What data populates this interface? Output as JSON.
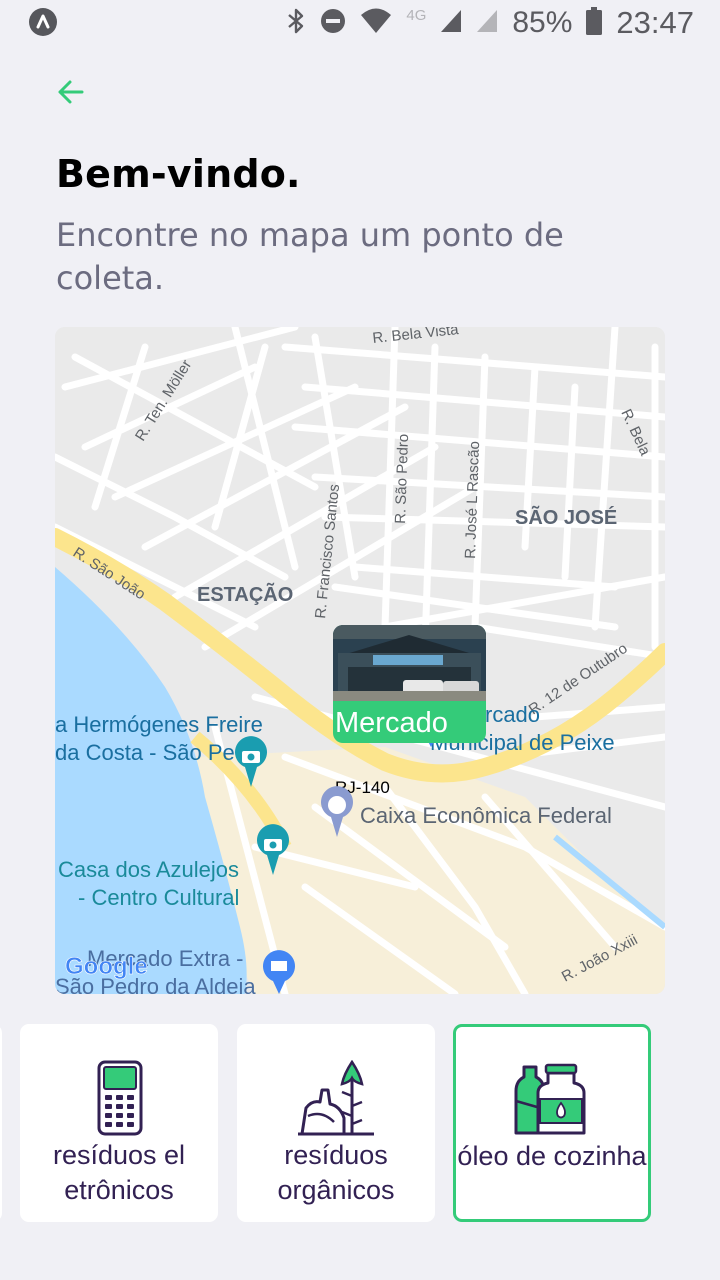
{
  "status_bar": {
    "network": "4G",
    "battery_percent": "85%",
    "time": "23:47",
    "icons": [
      "app-notification-icon",
      "bluetooth-icon",
      "do-not-disturb-icon",
      "wifi-icon",
      "signal-icon",
      "signal-icon",
      "battery-icon"
    ]
  },
  "header": {
    "back_icon": "arrow-left-icon",
    "title": "Bem-vindo.",
    "subtitle": "Encontre no mapa um ponto de coleta."
  },
  "map": {
    "streets": [
      "R. Bela Vista",
      "R. Ten. Möller",
      "R. Bela",
      "R. São Pedro",
      "R. José L Rascão",
      "R. Francisco Santos",
      "R. São João",
      "R. 12 de Outubro",
      "RJ-140",
      "R. João Xxiii"
    ],
    "neighborhoods": [
      "SÃO JOSÉ",
      "ESTAÇÃO"
    ],
    "places": [
      {
        "line1": "a Hermógenes Freire",
        "line2": "da Costa - São Pedro"
      },
      {
        "line1": "rcado",
        "line2": "Municipal de Peixe"
      },
      {
        "line1": "Caixa Econômica Federal",
        "line2": ""
      },
      {
        "line1": "Casa dos Azulejos",
        "line2": "- Centro Cultural"
      },
      {
        "line1": "Mercado Extra -",
        "line2": "São Pedro da Aldeia"
      }
    ],
    "attribution": "Google",
    "marker": {
      "name": "Mercado"
    },
    "colors": {
      "water": "#AADAFF",
      "highway": "#FCE58D",
      "land": "#EAEAEA",
      "road": "#FFFFFF",
      "poi": "#1A9DB0"
    }
  },
  "items": [
    {
      "label": "resíduos el etrônicos",
      "icon": "payment-terminal-icon",
      "selected": false
    },
    {
      "label": "resíduos orgânicos",
      "icon": "organic-waste-icon",
      "selected": false
    },
    {
      "label": "óleo de cozinha",
      "icon": "oil-bottles-icon",
      "selected": true
    }
  ],
  "colors": {
    "accent": "#34CB79",
    "title": "#000000",
    "text": "#6C6C80",
    "card_text": "#322153",
    "background": "#F0F0F5"
  }
}
